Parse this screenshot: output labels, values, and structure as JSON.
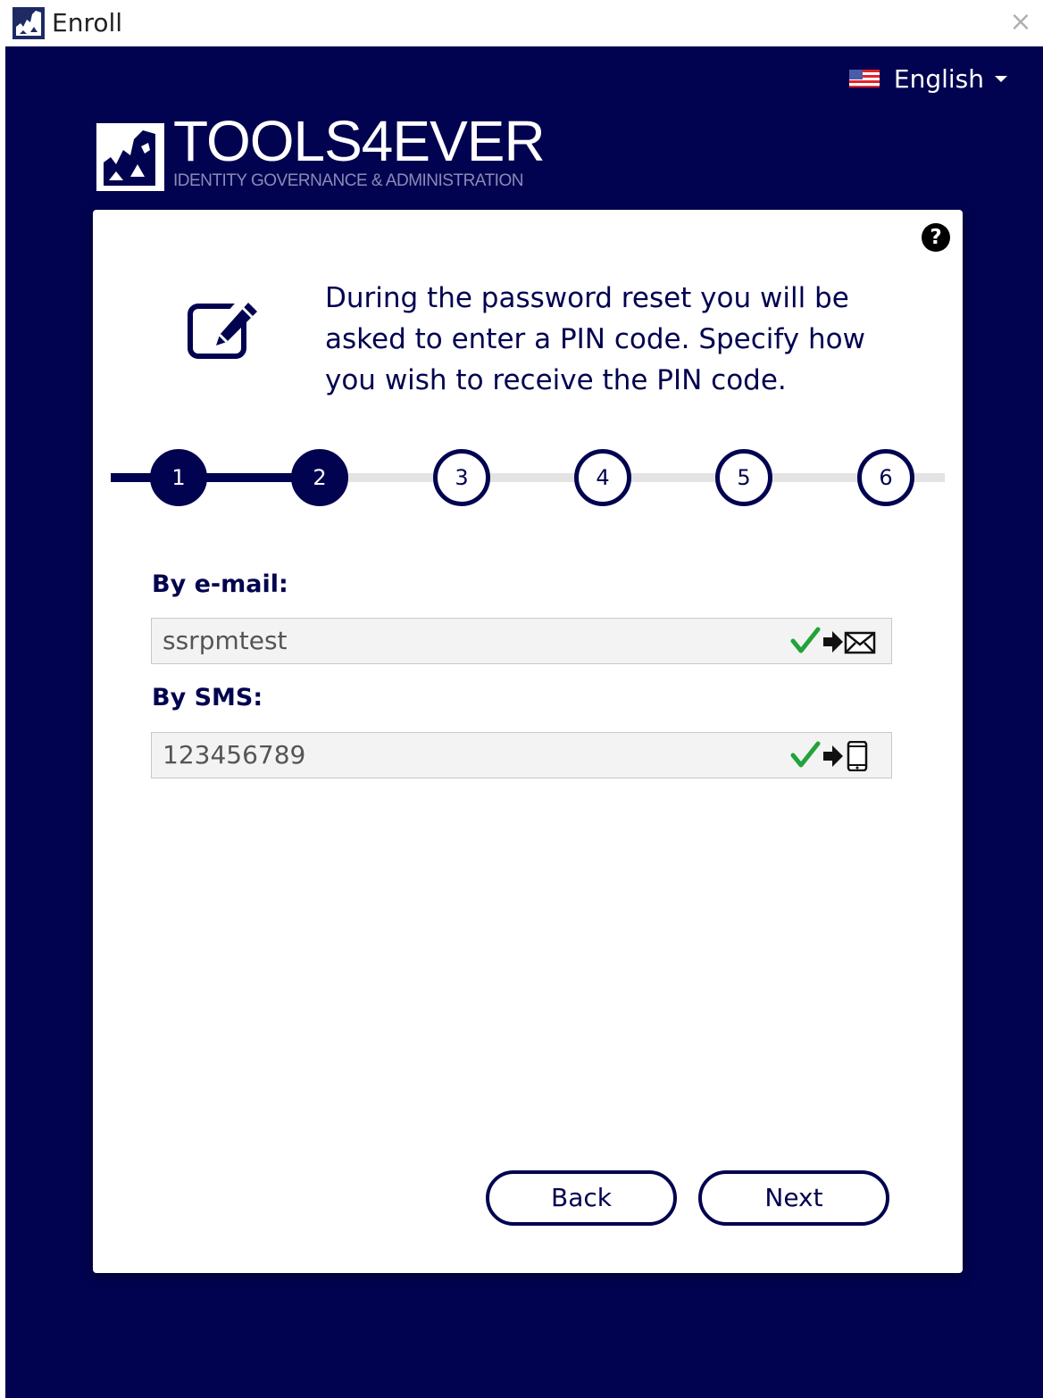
{
  "window": {
    "title": "Enroll",
    "close_label": "×"
  },
  "language": {
    "selected": "English"
  },
  "brand": {
    "name": "TOOLS4EVER",
    "tagline": "IDENTITY GOVERNANCE & ADMINISTRATION",
    "primary_color": "#020350"
  },
  "card": {
    "help_label": "?",
    "intro": "During the password reset you will be asked to enter a PIN code. Specify how you wish to receive the PIN code."
  },
  "steps": {
    "current": 2,
    "items": [
      "1",
      "2",
      "3",
      "4",
      "5",
      "6"
    ]
  },
  "fields": {
    "email": {
      "label": "By e-mail:",
      "value": "ssrpmtest",
      "status_icon": "check-icon",
      "action_icon": "send-email-icon"
    },
    "sms": {
      "label": "By SMS:",
      "value": "123456789",
      "status_icon": "check-icon",
      "action_icon": "send-sms-icon"
    }
  },
  "buttons": {
    "back": "Back",
    "next": "Next"
  }
}
